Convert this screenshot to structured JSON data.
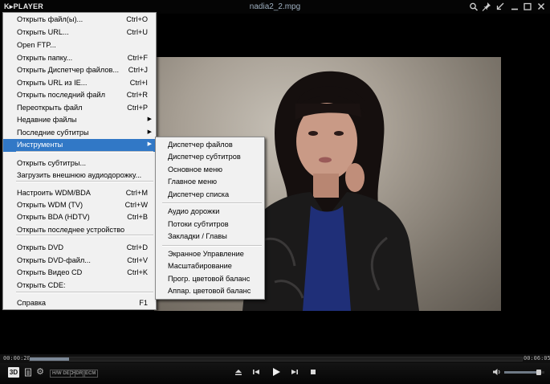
{
  "app": {
    "logo": "K▸PLAYER",
    "title": "nadia2_2.mpg"
  },
  "titlebar_buttons": [
    "search-icon",
    "pin-icon",
    "shrink-icon",
    "minimize-icon",
    "maximize-icon",
    "close-icon"
  ],
  "player": {
    "time_elapsed": "00:00:28",
    "time_total": "00:06:05",
    "progress_fraction": 0.08,
    "volume_fraction": 0.85,
    "mode_badge": "3D",
    "tags": [
      "H/W DEC",
      "HDR",
      "ECM"
    ]
  },
  "main_menu": {
    "items": [
      {
        "label": "Открыть файл(ы)...",
        "shortcut": "Ctrl+O"
      },
      {
        "label": "Открыть URL...",
        "shortcut": "Ctrl+U"
      },
      {
        "label": "Open FTP...",
        "shortcut": ""
      },
      {
        "label": "Открыть папку...",
        "shortcut": "Ctrl+F"
      },
      {
        "label": "Открыть Диспетчер файлов...",
        "shortcut": "Ctrl+J"
      },
      {
        "label": "Открыть URL из IE...",
        "shortcut": "Ctrl+I"
      },
      {
        "label": "Открыть последний файл",
        "shortcut": "Ctrl+R"
      },
      {
        "label": "Переоткрыть файл",
        "shortcut": "Ctrl+P"
      },
      {
        "label": "Недавние файлы",
        "shortcut": ""
      },
      {
        "label": "Последние субтитры",
        "shortcut": ""
      },
      {
        "label": "Инструменты",
        "shortcut": ""
      },
      {
        "label": "Открыть субтитры...",
        "shortcut": ""
      },
      {
        "label": "Загрузить внешнюю аудиодорожку...",
        "shortcut": ""
      },
      {
        "label": "Настроить WDM/BDA",
        "shortcut": "Ctrl+M"
      },
      {
        "label": "Открыть WDM (TV)",
        "shortcut": "Ctrl+W"
      },
      {
        "label": "Открыть BDA (HDTV)",
        "shortcut": "Ctrl+B"
      },
      {
        "label": "Открыть последнее устройство",
        "shortcut": ""
      },
      {
        "label": "Открыть DVD",
        "shortcut": "Ctrl+D"
      },
      {
        "label": "Открыть DVD-файл...",
        "shortcut": "Ctrl+V"
      },
      {
        "label": "Открыть Видео CD",
        "shortcut": "Ctrl+K"
      },
      {
        "label": "Открыть CDE:",
        "shortcut": ""
      },
      {
        "label": "Справка",
        "shortcut": "F1"
      }
    ],
    "highlighted": "Инструменты",
    "submenu_arrow": "▶"
  },
  "tools_submenu": {
    "items": [
      "Диспетчер файлов",
      "Диспетчер субтитров",
      "Основное меню",
      "Главное меню",
      "Диспетчер списка",
      "Аудио дорожки",
      "Потоки субтитров",
      "Закладки / Главы",
      "Экранное Управление",
      "Масштабирование",
      "Прогр. цветовой баланс",
      "Аппар. цветовой баланс"
    ]
  }
}
